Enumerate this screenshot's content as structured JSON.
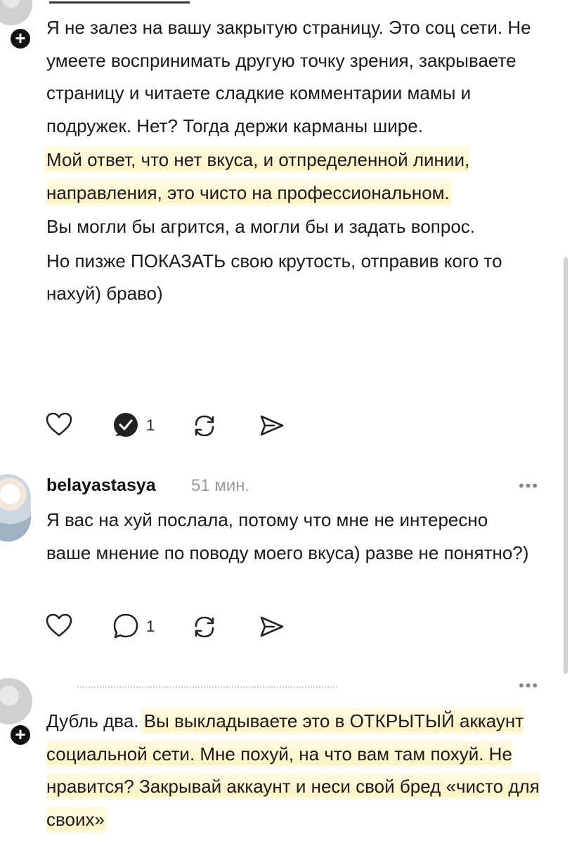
{
  "comment1": {
    "paragraphs": [
      "Я не залез на вашу закрытую страницу. Это соц сети. Не умеете воспринимать другую точку зрения, закрываете страницу и читаете сладкие комментарии мамы и подружек. Нет? Тогда держи карманы шире.",
      "Мой ответ, что нет вкуса, и отпределенной линии, направления, это чисто на профессиональном.",
      "Вы могли бы агрится, а могли бы и задать вопрос.",
      "Но пизже ПОКАЗАТЬ свою крутость, отправив кого то нахуй) браво)"
    ],
    "reply_count": "1"
  },
  "comment2": {
    "username": "belayastasya",
    "time": "51 мин.",
    "text": "Я вас на хуй послала, потому что мне не интересно ваше мнение по поводу моего вкуса) разве не понятно?)",
    "reply_count": "1"
  },
  "comment3": {
    "text_plain": "Дубль два.",
    "text_highlighted": "Вы выкладываете это в ОТКРЫТЫЙ аккаунт социальной сети. Мне похуй, на что вам там похуй. Не нравится? Закрывай аккаунт и неси свой бред «чисто для своих»"
  },
  "more_label": "•••",
  "icons": {
    "like": "heart-icon",
    "reply": "comment-icon",
    "repost": "repost-icon",
    "share": "send-icon",
    "follow": "plus-icon"
  },
  "colors": {
    "highlight": "#fff6cf",
    "muted": "#9a9a9a",
    "text": "#1a1a1a"
  }
}
